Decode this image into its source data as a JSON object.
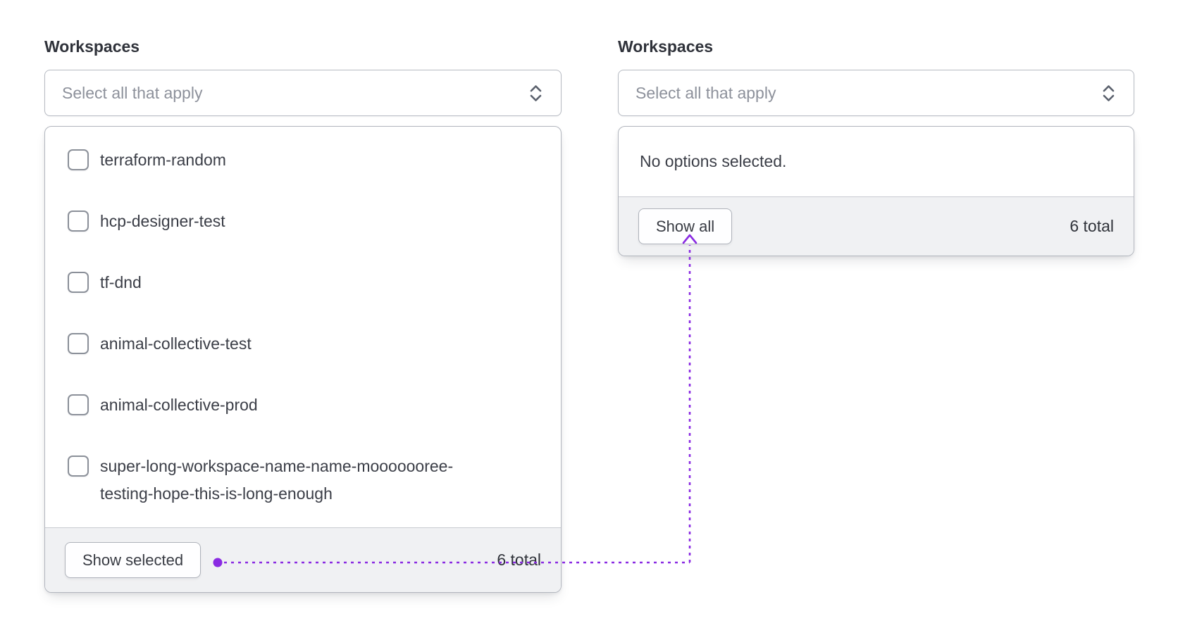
{
  "left": {
    "label": "Workspaces",
    "placeholder": "Select all that apply",
    "options": [
      "terraform-random",
      "hcp-designer-test",
      "tf-dnd",
      "animal-collective-test",
      "animal-collective-prod",
      "super-long-workspace-name-name-mooooooree-testing-hope-this-is-long-enough"
    ],
    "footer": {
      "button_label": "Show selected",
      "total_label": "6 total"
    }
  },
  "right": {
    "label": "Workspaces",
    "placeholder": "Select all that apply",
    "empty_message": "No options selected.",
    "footer": {
      "button_label": "Show all",
      "total_label": "6 total"
    }
  },
  "icons": {
    "select_toggle": "up-down-chevron"
  },
  "annotation": {
    "color": "#8A2BE2",
    "connects": "show-selected-button to show-all-button"
  }
}
